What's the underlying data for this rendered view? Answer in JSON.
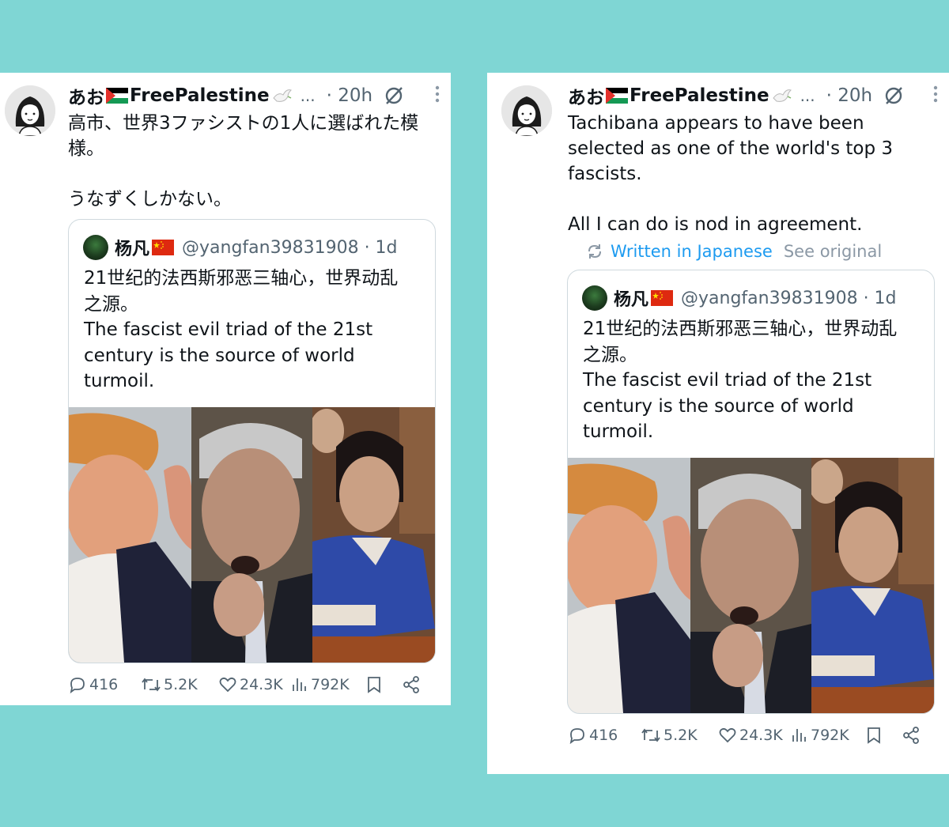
{
  "left_post": {
    "author_name_a": "あお",
    "author_name_b": "FreePalestine",
    "ellipsis": "...",
    "time": "· 20h",
    "text": "高市、世界3ファシストの1人に選ばれた模\n様。\n\nうなずくしかない。",
    "quote": {
      "name": "杨凡",
      "handle": "@yangfan39831908 · 1d",
      "text": "21世纪的法西斯邪恶三轴心，世界动乱\n之源。\nThe fascist evil triad of the 21st\ncentury is the source of world\nturmoil."
    },
    "actions": {
      "replies": "416",
      "reposts": "5.2K",
      "likes": "24.3K",
      "views": "792K"
    }
  },
  "right_post": {
    "author_name_a": "あお",
    "author_name_b": "FreePalestine",
    "ellipsis": "...",
    "time": "· 20h",
    "text": "Tachibana appears to have been\nselected as one of the world's top 3\nfascists.\n\nAll I can do is nod in agreement.",
    "translation": {
      "written_in": "Written in Japanese",
      "see_original": "See original"
    },
    "quote": {
      "name": "杨凡",
      "handle": "@yangfan39831908 · 1d",
      "text": "21世纪的法西斯邪恶三轴心，世界动乱\n之源。\nThe fascist evil triad of the 21st\ncentury is the source of world\nturmoil."
    },
    "actions": {
      "replies": "416",
      "reposts": "5.2K",
      "likes": "24.3K",
      "views": "792K"
    }
  },
  "icons": [
    "avatar",
    "palestine-flag-icon",
    "dove-icon",
    "grok-icon",
    "more-icon",
    "china-flag-icon",
    "reply-icon",
    "repost-icon",
    "like-icon",
    "views-icon",
    "bookmark-icon",
    "share-icon",
    "translate-icon"
  ],
  "colors": {
    "background": "#7fd6d4",
    "card": "#ffffff",
    "link_blue": "#1d9bf0",
    "muted": "#536471"
  }
}
